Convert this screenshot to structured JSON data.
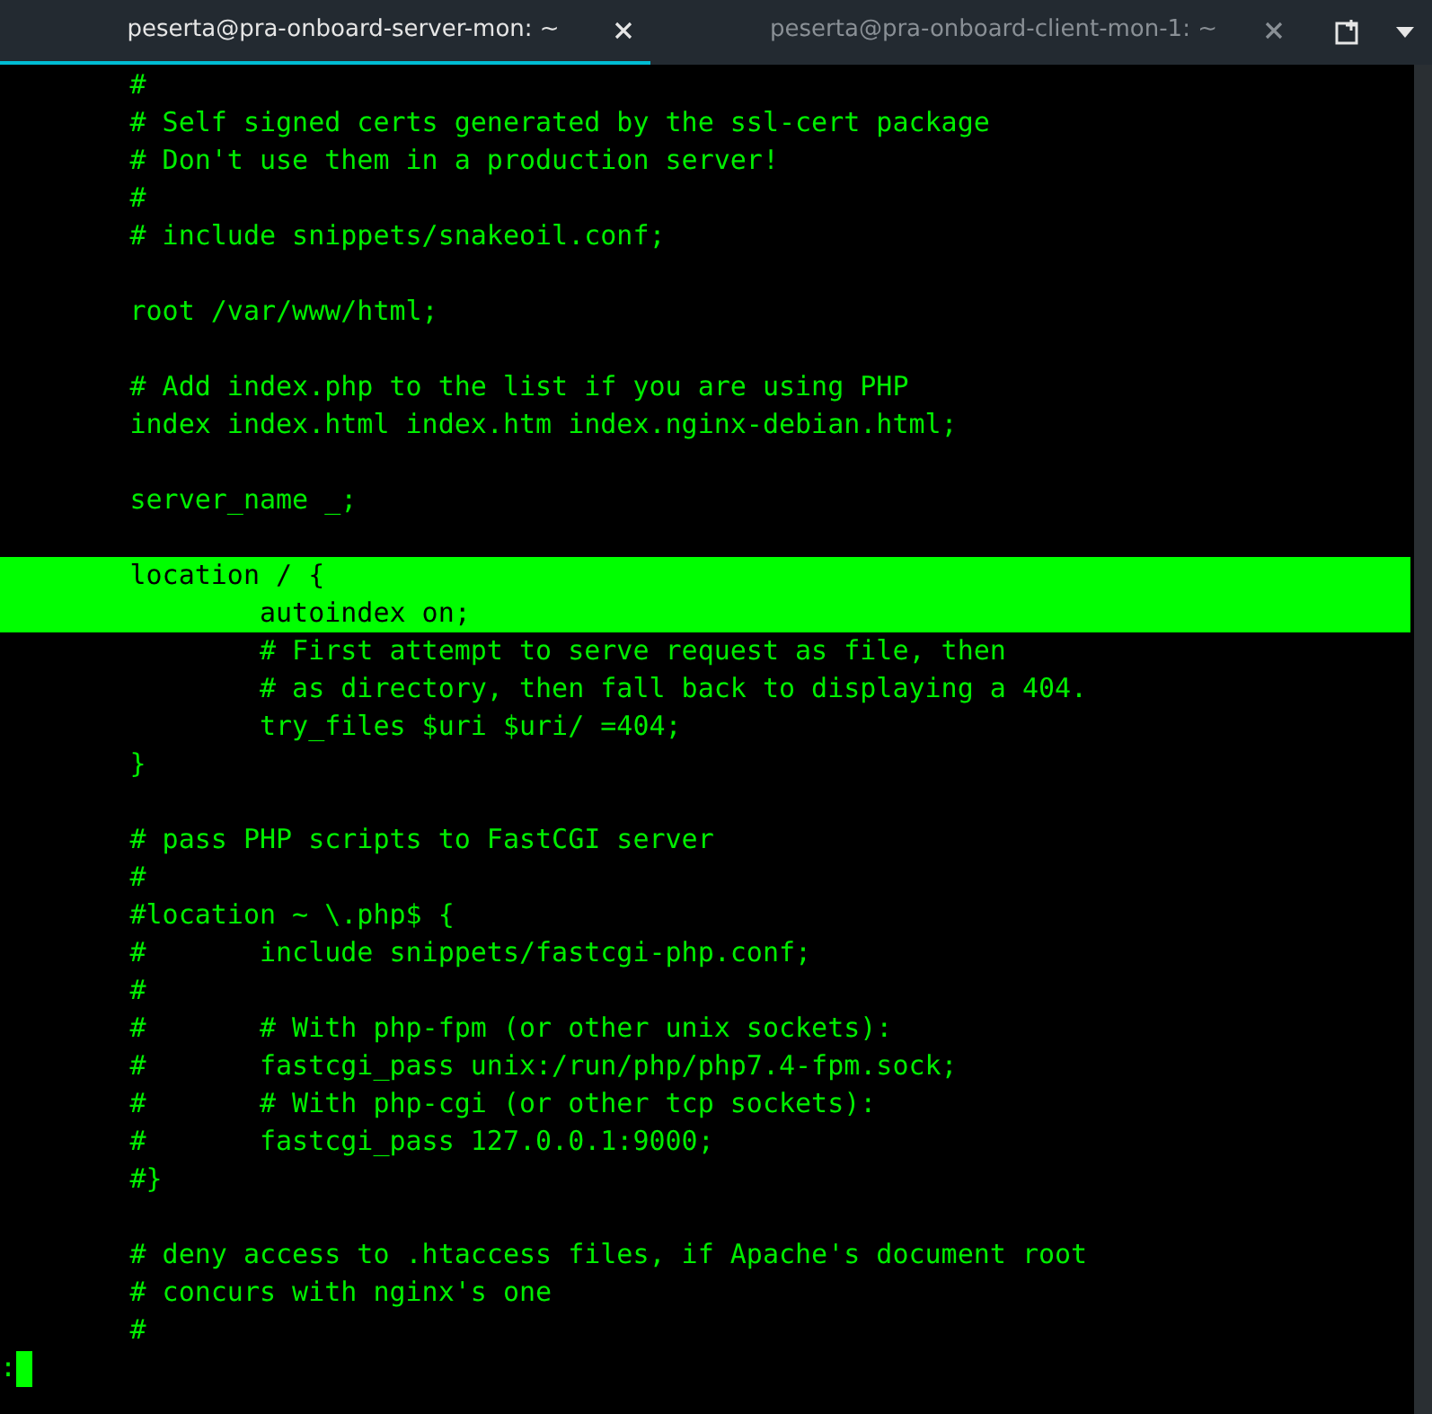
{
  "tabs": [
    {
      "title": "peserta@pra-onboard-server-mon: ~",
      "selected": true
    },
    {
      "title": "peserta@pra-onboard-client-mon-1: ~",
      "selected": false
    }
  ],
  "lines": [
    {
      "kind": "code",
      "text": "        #",
      "selected": false
    },
    {
      "kind": "code",
      "text": "        # Self signed certs generated by the ssl-cert package",
      "selected": false
    },
    {
      "kind": "code",
      "text": "        # Don't use them in a production server!",
      "selected": false
    },
    {
      "kind": "code",
      "text": "        #",
      "selected": false
    },
    {
      "kind": "code",
      "text": "        # include snippets/snakeoil.conf;",
      "selected": false
    },
    {
      "kind": "blank"
    },
    {
      "kind": "code",
      "text": "        root /var/www/html;",
      "selected": false
    },
    {
      "kind": "blank"
    },
    {
      "kind": "code",
      "text": "        # Add index.php to the list if you are using PHP",
      "selected": false
    },
    {
      "kind": "code",
      "text": "        index index.html index.htm index.nginx-debian.html;",
      "selected": false
    },
    {
      "kind": "blank"
    },
    {
      "kind": "code",
      "text": "        server_name _;",
      "selected": false
    },
    {
      "kind": "blank"
    },
    {
      "kind": "code",
      "text": "        location / {",
      "selected": true
    },
    {
      "kind": "code",
      "text": "                autoindex on;",
      "selected": true
    },
    {
      "kind": "code",
      "text": "                # First attempt to serve request as file, then",
      "selected": false
    },
    {
      "kind": "code",
      "text": "                # as directory, then fall back to displaying a 404.",
      "selected": false
    },
    {
      "kind": "code",
      "text": "                try_files $uri $uri/ =404;",
      "selected": false
    },
    {
      "kind": "code",
      "text": "        }",
      "selected": false
    },
    {
      "kind": "blank"
    },
    {
      "kind": "code",
      "text": "        # pass PHP scripts to FastCGI server",
      "selected": false
    },
    {
      "kind": "code",
      "text": "        #",
      "selected": false
    },
    {
      "kind": "code",
      "text": "        #location ~ \\.php$ {",
      "selected": false
    },
    {
      "kind": "code",
      "text": "        #       include snippets/fastcgi-php.conf;",
      "selected": false
    },
    {
      "kind": "code",
      "text": "        #",
      "selected": false
    },
    {
      "kind": "code",
      "text": "        #       # With php-fpm (or other unix sockets):",
      "selected": false
    },
    {
      "kind": "code",
      "text": "        #       fastcgi_pass unix:/run/php/php7.4-fpm.sock;",
      "selected": false
    },
    {
      "kind": "code",
      "text": "        #       # With php-cgi (or other tcp sockets):",
      "selected": false
    },
    {
      "kind": "code",
      "text": "        #       fastcgi_pass 127.0.0.1:9000;",
      "selected": false
    },
    {
      "kind": "code",
      "text": "        #}",
      "selected": false
    },
    {
      "kind": "blank"
    },
    {
      "kind": "code",
      "text": "        # deny access to .htaccess files, if Apache's document root",
      "selected": false
    },
    {
      "kind": "code",
      "text": "        # concurs with nginx's one",
      "selected": false
    },
    {
      "kind": "code",
      "text": "        #",
      "selected": false
    }
  ],
  "prompt": ":"
}
